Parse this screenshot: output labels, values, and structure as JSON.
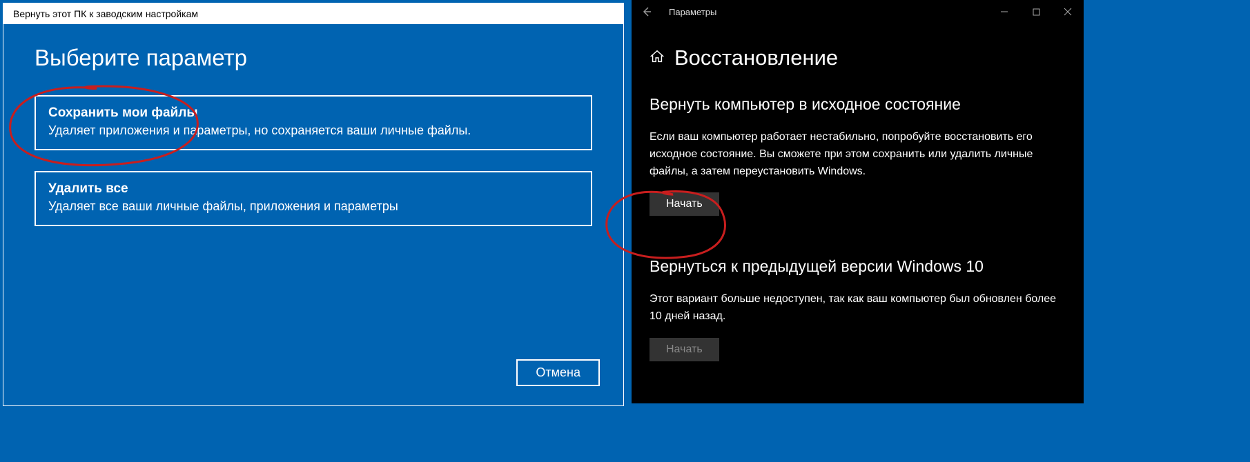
{
  "left": {
    "titlebar": "Вернуть этот ПК к заводским настройкам",
    "heading": "Выберите параметр",
    "options": [
      {
        "title": "Сохранить мои файлы",
        "desc": "Удаляет приложения и параметры, но сохраняется ваши личные файлы."
      },
      {
        "title": "Удалить все",
        "desc": "Удаляет все ваши личные файлы, приложения и параметры"
      }
    ],
    "cancel": "Отмена"
  },
  "right": {
    "titlebar": "Параметры",
    "heading": "Восстановление",
    "sections": [
      {
        "title": "Вернуть компьютер в исходное состояние",
        "desc": "Если ваш компьютер работает нестабильно, попробуйте восстановить его исходное состояние. Вы сможете при этом сохранить или удалить личные файлы, а затем переустановить Windows.",
        "button": "Начать",
        "enabled": true
      },
      {
        "title": "Вернуться к предыдущей версии Windows 10",
        "desc": "Этот вариант больше недоступен, так как ваш компьютер был обновлен более 10 дней назад.",
        "button": "Начать",
        "enabled": false
      }
    ]
  },
  "annotation_color": "#c81e1e"
}
